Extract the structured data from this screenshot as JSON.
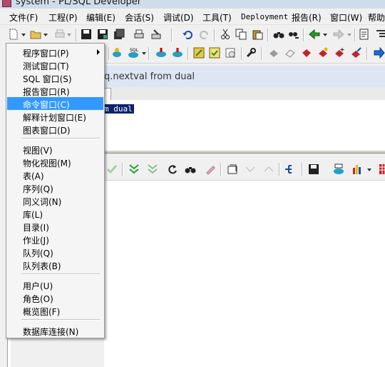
{
  "window": {
    "title": "system - PL/SQL Developer"
  },
  "menubar": [
    {
      "label": "文件(F)"
    },
    {
      "label": "工程(P)"
    },
    {
      "label": "编辑(E)"
    },
    {
      "label": "会话(S)"
    },
    {
      "label": "调试(D)"
    },
    {
      "label": "工具(T)"
    },
    {
      "label": "Deployment"
    },
    {
      "label": "报告(R)"
    },
    {
      "label": "窗口(W)"
    },
    {
      "label": "帮助"
    }
  ],
  "document": {
    "title": "q.nextval from dual",
    "selected_text": "m dual"
  },
  "new_menu": {
    "groups": [
      [
        {
          "label": "程序窗口(P)",
          "submenu": true
        },
        {
          "label": "测试窗口(T)"
        },
        {
          "label": "SQL 窗口(S)"
        },
        {
          "label": "报告窗口(R)"
        },
        {
          "label": "命令窗口(C)",
          "highlighted": true
        },
        {
          "label": "解释计划窗口(E)"
        },
        {
          "label": "图表窗口(D)"
        }
      ],
      [
        {
          "label": "视图(V)"
        },
        {
          "label": "物化视图(M)"
        },
        {
          "label": "表(A)"
        },
        {
          "label": "序列(Q)"
        },
        {
          "label": "同义词(N)"
        },
        {
          "label": "库(L)"
        },
        {
          "label": "目录(I)"
        },
        {
          "label": "作业(J)"
        },
        {
          "label": "队列(Q)"
        },
        {
          "label": "队列表(B)"
        }
      ],
      [
        {
          "label": "用户(U)"
        },
        {
          "label": "角色(O)"
        },
        {
          "label": "概览图(F)"
        }
      ],
      [
        {
          "label": "数据库连接(N)"
        }
      ]
    ]
  },
  "colors": {
    "highlight": "#3399ff",
    "selection": "#0a246a"
  }
}
